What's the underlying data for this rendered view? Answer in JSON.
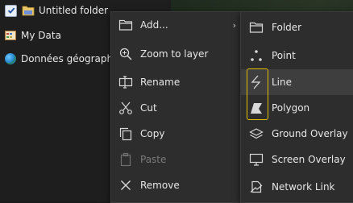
{
  "places": {
    "items": [
      {
        "label": "Untitled folder",
        "checked": true,
        "icon": "folder-icon"
      },
      {
        "label": "My Data",
        "icon": "mydata-icon"
      },
      {
        "label": "Données géographiques",
        "icon": "globe-icon"
      }
    ]
  },
  "context_menu": {
    "items": [
      {
        "label": "Add...",
        "icon": "folder-icon",
        "has_submenu": true
      },
      {
        "label": "Zoom to layer",
        "icon": "zoom-icon"
      },
      {
        "label": "Rename",
        "icon": "rename-icon"
      },
      {
        "label": "Cut",
        "icon": "scissors-icon"
      },
      {
        "label": "Copy",
        "icon": "copy-icon"
      },
      {
        "label": "Paste",
        "icon": "paste-icon",
        "disabled": true
      },
      {
        "label": "Remove",
        "icon": "close-icon"
      }
    ],
    "submenu_arrow": "›"
  },
  "add_submenu": {
    "items": [
      {
        "label": "Folder",
        "icon": "folder-icon"
      },
      {
        "label": "Point",
        "icon": "point-icon"
      },
      {
        "label": "Line",
        "icon": "line-icon",
        "highlighted": true
      },
      {
        "label": "Polygon",
        "icon": "polygon-icon"
      },
      {
        "label": "Ground Overlay",
        "icon": "ground-overlay-icon"
      },
      {
        "label": "Screen Overlay",
        "icon": "screen-overlay-icon"
      },
      {
        "label": "Network Link",
        "icon": "network-link-icon"
      }
    ]
  },
  "colors": {
    "menu_bg": "#2d2d2d",
    "highlight_box": "#e3c000",
    "text": "#e6e6e6",
    "disabled_text": "#7a7a7a"
  }
}
